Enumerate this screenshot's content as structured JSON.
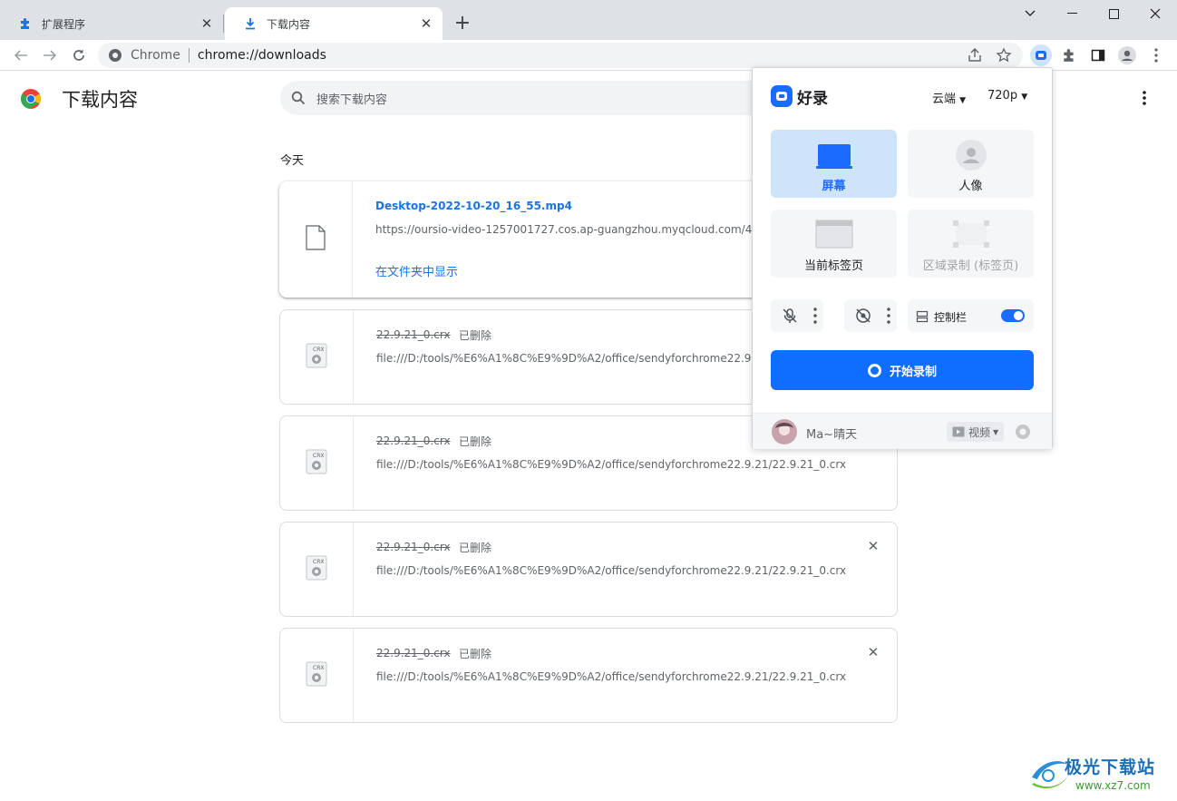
{
  "browser": {
    "tabs": [
      {
        "title": "扩展程序",
        "icon": "puzzle-icon"
      },
      {
        "title": "下载内容",
        "icon": "download-icon"
      }
    ],
    "omnibox": {
      "site": "Chrome",
      "url": "chrome://downloads"
    }
  },
  "page": {
    "title": "下载内容",
    "search_placeholder": "搜索下载内容",
    "date_group": "今天"
  },
  "downloads": [
    {
      "name": "Desktop-2022-10-20_16_55.mp4",
      "status": "",
      "url": "https://oursio-video-1257001727.cos.ap-guangzhou.myqcloud.com/4b9",
      "action": "在文件夹中显示",
      "icon": "file-icon"
    },
    {
      "name": "22.9.21_0.crx",
      "status": "已删除",
      "url": "file:///D:/tools/%E6%A1%8C%E9%9D%A2/office/sendyforchrome22.9.21/",
      "icon": "crx-file-icon"
    },
    {
      "name": "22.9.21_0.crx",
      "status": "已删除",
      "url": "file:///D:/tools/%E6%A1%8C%E9%9D%A2/office/sendyforchrome22.9.21/22.9.21_0.crx",
      "icon": "crx-file-icon"
    },
    {
      "name": "22.9.21_0.crx",
      "status": "已删除",
      "url": "file:///D:/tools/%E6%A1%8C%E9%9D%A2/office/sendyforchrome22.9.21/22.9.21_0.crx",
      "icon": "crx-file-icon"
    },
    {
      "name": "22.9.21_0.crx",
      "status": "已删除",
      "url": "file:///D:/tools/%E6%A1%8C%E9%9D%A2/office/sendyforchrome22.9.21/22.9.21_0.crx",
      "icon": "crx-file-icon"
    }
  ],
  "popup": {
    "brand": "好录",
    "storage": "云端",
    "resolution": "720p",
    "modes": [
      {
        "label": "屏幕",
        "selected": true
      },
      {
        "label": "人像",
        "selected": false
      },
      {
        "label": "当前标签页",
        "selected": false
      },
      {
        "label": "区域录制 (标签页)",
        "disabled": true
      }
    ],
    "control_bar_label": "控制栏",
    "control_bar_on": true,
    "start_label": "开始录制",
    "user_name": "Ma~晴天",
    "video_label": "视频",
    "accent": "#0f6dff"
  },
  "watermark": {
    "text": "极光下载站",
    "site": "www.xz7.com"
  }
}
